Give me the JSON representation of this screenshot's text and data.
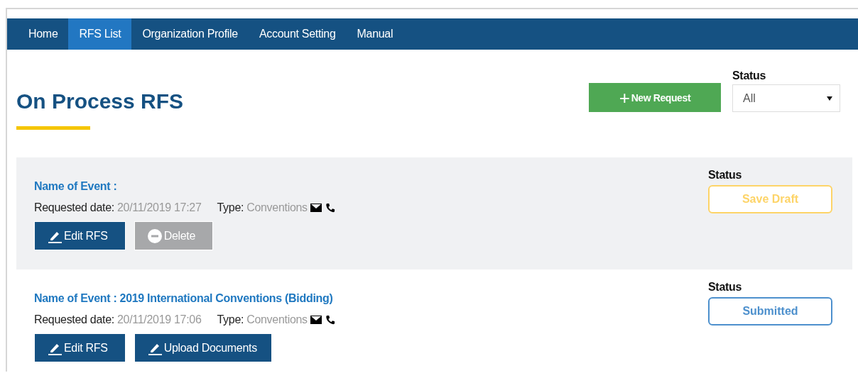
{
  "nav": [
    {
      "label": "Home",
      "selected": false
    },
    {
      "label": "RFS List",
      "selected": true
    },
    {
      "label": "Organization Profile",
      "selected": false
    },
    {
      "label": "Account Setting",
      "selected": false
    },
    {
      "label": "Manual",
      "selected": false
    }
  ],
  "page_title": "On Process RFS",
  "new_request_button": {
    "icon": "+",
    "label": "New Request"
  },
  "status_filter": {
    "label": "Status",
    "value": "All"
  },
  "requests": [
    {
      "title": "Name of Event :",
      "date_label": "Requested date:",
      "date": "20/11/2019 17:27",
      "type_label": "Type:",
      "type": "Conventions",
      "status_label": "Status",
      "status": {
        "kind": "draft",
        "label": "Save Draft"
      },
      "highlighted": true,
      "buttons": [
        {
          "kind": "edit",
          "label": "Edit RFS"
        },
        {
          "kind": "delete",
          "label": "Delete"
        }
      ]
    },
    {
      "title": "Name of Event : 2019 International Conventions (Bidding)",
      "date_label": "Requested date:",
      "date": "20/11/2019 17:06",
      "type_label": "Type:",
      "type": "Conventions",
      "status_label": "Status",
      "status": {
        "kind": "submitted",
        "label": "Submitted"
      },
      "highlighted": false,
      "buttons": [
        {
          "kind": "edit",
          "label": "Edit RFS"
        },
        {
          "kind": "upload",
          "label": "Upload Documents"
        }
      ]
    }
  ]
}
